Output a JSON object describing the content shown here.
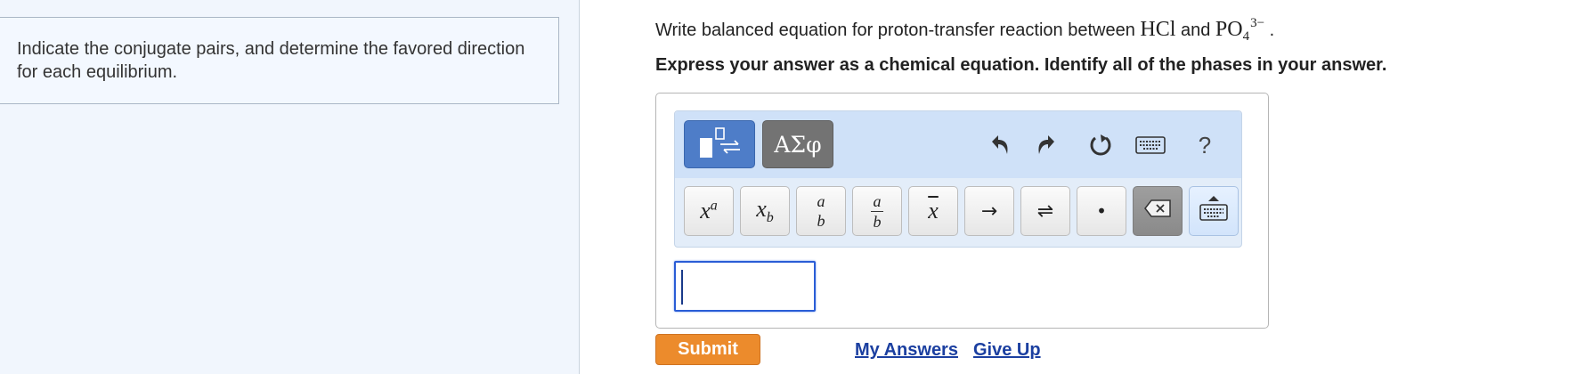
{
  "instructions": {
    "text": "Indicate the conjugate pairs, and determine the favored direction for each equilibrium."
  },
  "question": {
    "prefix": "Write balanced equation for proton-transfer reaction between ",
    "species1": "HCl",
    "connector": " and ",
    "species2_base": "PO",
    "species2_sub": "4",
    "species2_charge": "3−",
    "suffix": " ."
  },
  "express": "Express your answer as a chemical equation. Identify all of the phases in your answer.",
  "toolbar": {
    "greek_label": "ΑΣφ",
    "help_label": "?",
    "icons": [
      "templates-icon",
      "undo-icon",
      "redo-icon",
      "reset-icon",
      "keyboard-shortcuts-icon",
      "help-icon"
    ],
    "keys": {
      "superscript_base": "x",
      "superscript_exp": "a",
      "subscript_base": "x",
      "subscript_sub": "b",
      "fraction_num": "a",
      "fraction_den": "b",
      "fraction_bar_num": "a",
      "fraction_bar_den": "b",
      "overline": "x",
      "arrow": "→",
      "equilibrium": "⇌",
      "dot": "•"
    }
  },
  "colors": {
    "template_button": "#4e7dc8",
    "greek_button": "#737373",
    "submit": "#ec8b2c",
    "link": "#1b3fa0",
    "input_border": "#2a5dd6"
  },
  "actions": {
    "submit": "Submit",
    "my_answers": "My Answers",
    "give_up": "Give Up"
  }
}
